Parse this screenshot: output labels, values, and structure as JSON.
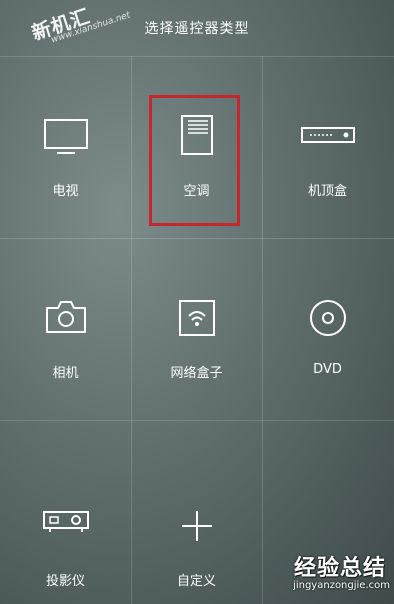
{
  "header": {
    "title": "选择遥控器类型"
  },
  "watermark_top": {
    "logo": "新机汇",
    "url": "www.xianshua.net"
  },
  "devices": [
    {
      "label": "电视",
      "icon": "tv-icon"
    },
    {
      "label": "空调",
      "icon": "air-conditioner-icon",
      "selected": true
    },
    {
      "label": "机顶盒",
      "icon": "set-top-box-icon"
    },
    {
      "label": "相机",
      "icon": "camera-icon"
    },
    {
      "label": "网络盒子",
      "icon": "network-box-icon"
    },
    {
      "label": "DVD",
      "icon": "dvd-icon"
    },
    {
      "label": "投影仪",
      "icon": "projector-icon"
    },
    {
      "label": "自定义",
      "icon": "plus-icon"
    }
  ],
  "watermark_bottom": {
    "brand": "经验总结",
    "site": "jingyanzongjie.com"
  },
  "colors": {
    "highlight": "#c6272c",
    "icon_stroke": "#ffffff"
  }
}
